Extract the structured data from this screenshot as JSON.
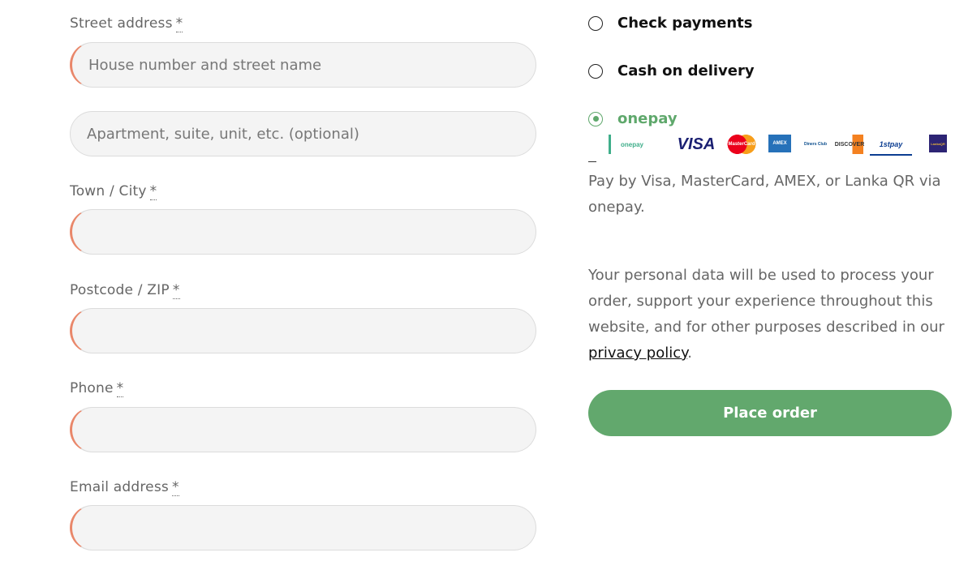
{
  "form": {
    "required_mark": "*",
    "street_label": "Street address",
    "street_placeholder": "House number and street name",
    "apartment_placeholder": "Apartment, suite, unit, etc. (optional)",
    "city_label": "Town / City",
    "postcode_label": "Postcode / ZIP",
    "phone_label": "Phone",
    "email_label": "Email address"
  },
  "payment": {
    "options": [
      {
        "label": "Check payments",
        "selected": false
      },
      {
        "label": "Cash on delivery",
        "selected": false
      },
      {
        "label": "onepay",
        "selected": true
      }
    ],
    "logos": [
      {
        "name": "onepay-logo",
        "text": "onepay"
      },
      {
        "name": "visa-logo",
        "text": "VISA"
      },
      {
        "name": "mastercard-logo",
        "text": "MasterCard"
      },
      {
        "name": "amex-logo",
        "text": "AMEX"
      },
      {
        "name": "diners-club-logo",
        "text": "Diners Club"
      },
      {
        "name": "discover-logo",
        "text": "DISCOVER"
      },
      {
        "name": "1stpay-logo",
        "text": "1stpay"
      },
      {
        "name": "lanka-qr-logo",
        "text": "LankaQR"
      }
    ],
    "description": "Pay by Visa, MasterCard, AMEX, or Lanka QR via onepay."
  },
  "privacy": {
    "text_before": "Your personal data will be used to process your order, support your experience throughout this website, and for other purposes described in our ",
    "link_text": "privacy policy",
    "text_after": "."
  },
  "place_order_label": "Place order",
  "colors": {
    "accent_green": "#62a86d",
    "error_border": "#e9876a"
  }
}
